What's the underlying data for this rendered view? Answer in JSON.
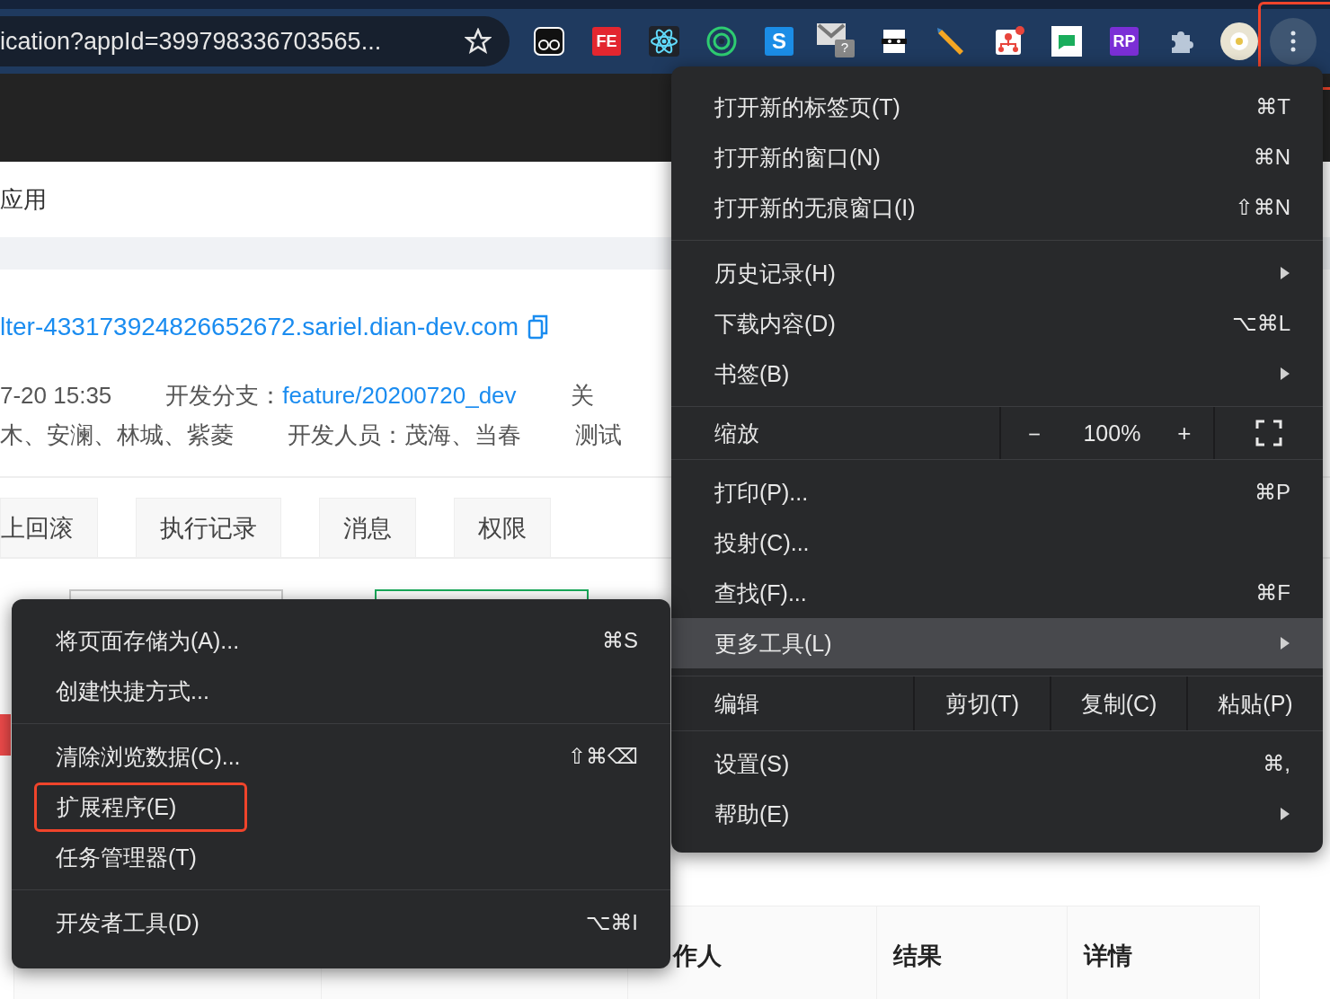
{
  "toolbar": {
    "url": "ication?appId=399798336703565...",
    "extensions": [
      {
        "kind": "glasses"
      },
      {
        "kind": "letter",
        "label": "FE",
        "color": "#e3262f"
      },
      {
        "kind": "atom"
      },
      {
        "kind": "ring"
      },
      {
        "kind": "letter",
        "label": "S",
        "color": "#1b8de6"
      },
      {
        "kind": "mail",
        "label": "?"
      },
      {
        "kind": "mask"
      },
      {
        "kind": "pencil"
      },
      {
        "kind": "tree"
      },
      {
        "kind": "chat"
      },
      {
        "kind": "letter",
        "label": "RP",
        "color": "#7b2fd6"
      },
      {
        "kind": "puzzle"
      },
      {
        "kind": "avatar"
      }
    ],
    "menu_button": {
      "outlined": true
    }
  },
  "page": {
    "title": "应用",
    "link": "lter-433173924826652672.sariel.dian-dev.com",
    "info_rows": [
      [
        {
          "text": "7-20 15:35"
        },
        {
          "text": "开发分支：",
          "link": "feature/20200720_dev"
        },
        {
          "text": "关"
        }
      ],
      [
        {
          "text": "木、安澜、林城、紫菱"
        },
        {
          "text": "开发人员：茂海、当春"
        },
        {
          "text": "测试"
        }
      ]
    ],
    "tabs": [
      "上回滚",
      "执行记录",
      "消息",
      "权限"
    ],
    "table": {
      "columns": [
        "作人",
        "结果",
        "详情"
      ]
    }
  },
  "main_menu": {
    "sections": [
      [
        {
          "kind": "item",
          "label": "打开新的标签页(T)",
          "shortcut": "⌘T",
          "submenu": false,
          "selected": false
        },
        {
          "kind": "item",
          "label": "打开新的窗口(N)",
          "shortcut": "⌘N",
          "submenu": false,
          "selected": false
        },
        {
          "kind": "item",
          "label": "打开新的无痕窗口(I)",
          "shortcut": "⇧⌘N",
          "submenu": false,
          "selected": false
        }
      ],
      [
        {
          "kind": "item",
          "label": "历史记录(H)",
          "submenu": true,
          "selected": false
        },
        {
          "kind": "item",
          "label": "下载内容(D)",
          "shortcut": "⌥⌘L",
          "submenu": false,
          "selected": false
        },
        {
          "kind": "item",
          "label": "书签(B)",
          "submenu": true,
          "selected": false
        }
      ],
      [
        {
          "kind": "zoom",
          "label": "缩放",
          "minus": "－",
          "value": "100%",
          "plus": "+"
        }
      ],
      [
        {
          "kind": "item",
          "label": "打印(P)...",
          "shortcut": "⌘P",
          "submenu": false,
          "selected": false
        },
        {
          "kind": "item",
          "label": "投射(C)...",
          "submenu": false,
          "selected": false
        },
        {
          "kind": "item",
          "label": "查找(F)...",
          "shortcut": "⌘F",
          "submenu": false,
          "selected": false
        },
        {
          "kind": "item",
          "label": "更多工具(L)",
          "submenu": true,
          "selected": true
        }
      ],
      [
        {
          "kind": "edit",
          "label": "编辑",
          "actions": [
            "剪切(T)",
            "复制(C)",
            "粘贴(P)"
          ]
        }
      ],
      [
        {
          "kind": "item",
          "label": "设置(S)",
          "shortcut": "⌘,",
          "submenu": false,
          "selected": false
        },
        {
          "kind": "item",
          "label": "帮助(E)",
          "submenu": true,
          "selected": false
        }
      ]
    ]
  },
  "sub_menu": {
    "sections": [
      [
        {
          "label": "将页面存储为(A)...",
          "shortcut": "⌘S",
          "outlined": false
        },
        {
          "label": "创建快捷方式...",
          "outlined": false
        }
      ],
      [
        {
          "label": "清除浏览数据(C)...",
          "shortcut": "⇧⌘⌫",
          "outlined": false
        },
        {
          "label": "扩展程序(E)",
          "outlined": true
        },
        {
          "label": "任务管理器(T)",
          "outlined": false
        }
      ],
      [
        {
          "label": "开发者工具(D)",
          "shortcut": "⌥⌘I",
          "outlined": false
        }
      ]
    ]
  }
}
